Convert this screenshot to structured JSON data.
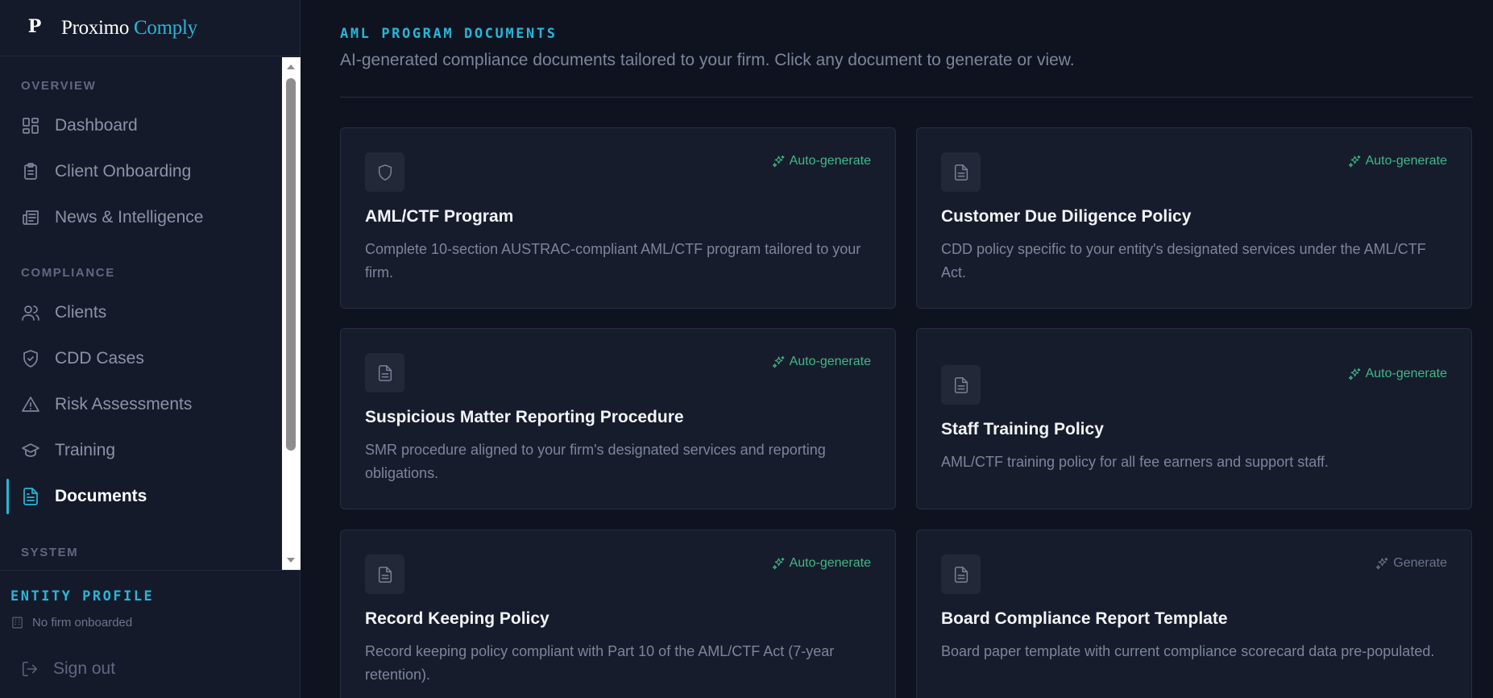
{
  "brand": {
    "logo_letter": "P",
    "name": "Proximo",
    "accent": "Comply"
  },
  "sidebar": {
    "sections": [
      {
        "label": "OVERVIEW"
      },
      {
        "label": "COMPLIANCE"
      },
      {
        "label": "SYSTEM"
      }
    ],
    "items": [
      {
        "label": "Dashboard",
        "icon": "dashboard-icon"
      },
      {
        "label": "Client Onboarding",
        "icon": "clipboard-icon"
      },
      {
        "label": "News & Intelligence",
        "icon": "newspaper-icon"
      },
      {
        "label": "Clients",
        "icon": "users-icon"
      },
      {
        "label": "CDD Cases",
        "icon": "shield-check-icon"
      },
      {
        "label": "Risk Assessments",
        "icon": "warning-icon"
      },
      {
        "label": "Training",
        "icon": "graduation-cap-icon"
      },
      {
        "label": "Documents",
        "icon": "document-icon",
        "active": true
      }
    ]
  },
  "entity": {
    "title": "ENTITY PROFILE",
    "firm": "No firm onboarded",
    "signout": "Sign out"
  },
  "main": {
    "eyebrow": "AML PROGRAM DOCUMENTS",
    "subtitle": "AI-generated compliance documents tailored to your firm. Click any document to generate or view.",
    "cards": [
      {
        "title": "AML/CTF Program",
        "desc": "Complete 10-section AUSTRAC-compliant AML/CTF program tailored to your firm.",
        "action": "Auto-generate",
        "icon": "shield-icon"
      },
      {
        "title": "Customer Due Diligence Policy",
        "desc": "CDD policy specific to your entity's designated services under the AML/CTF Act.",
        "action": "Auto-generate",
        "icon": "document-icon"
      },
      {
        "title": "Suspicious Matter Reporting Procedure",
        "desc": "SMR procedure aligned to your firm's designated services and reporting obligations.",
        "action": "Auto-generate",
        "icon": "document-icon"
      },
      {
        "title": "Staff Training Policy",
        "desc": "AML/CTF training policy for all fee earners and support staff.",
        "action": "Auto-generate",
        "icon": "document-icon"
      },
      {
        "title": "Record Keeping Policy",
        "desc": "Record keeping policy compliant with Part 10 of the AML/CTF Act (7-year retention).",
        "action": "Auto-generate",
        "icon": "document-icon"
      },
      {
        "title": "Board Compliance Report Template",
        "desc": "Board paper template with current compliance scorecard data pre-populated.",
        "action": "Generate",
        "icon": "document-icon"
      }
    ]
  },
  "colors": {
    "accent": "#29b6d6",
    "success": "#3fb984",
    "background": "#0f1320",
    "sidebar": "#151a2b"
  }
}
